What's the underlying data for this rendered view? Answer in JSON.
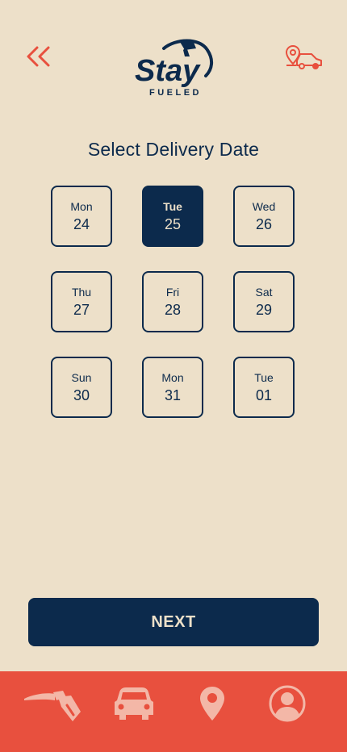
{
  "header": {
    "back_icon": "double-chevron-left-icon",
    "logo_top": "Stay",
    "logo_bottom": "FUELED",
    "right_icon": "car-location-pin-icon"
  },
  "title": "Select Delivery Date",
  "dates": [
    {
      "day": "Mon",
      "num": "24",
      "selected": false
    },
    {
      "day": "Tue",
      "num": "25",
      "selected": true
    },
    {
      "day": "Wed",
      "num": "26",
      "selected": false
    },
    {
      "day": "Thu",
      "num": "27",
      "selected": false
    },
    {
      "day": "Fri",
      "num": "28",
      "selected": false
    },
    {
      "day": "Sat",
      "num": "29",
      "selected": false
    },
    {
      "day": "Sun",
      "num": "30",
      "selected": false
    },
    {
      "day": "Mon",
      "num": "31",
      "selected": false
    },
    {
      "day": "Tue",
      "num": "01",
      "selected": false
    }
  ],
  "next_label": "NEXT",
  "nav": {
    "items": [
      "fuel-nozzle-icon",
      "car-icon",
      "location-pin-icon",
      "profile-icon"
    ]
  },
  "colors": {
    "background": "#ede0c9",
    "navy": "#0c2a4c",
    "accent": "#e8503e",
    "nav_icon": "#f3b7a7"
  }
}
